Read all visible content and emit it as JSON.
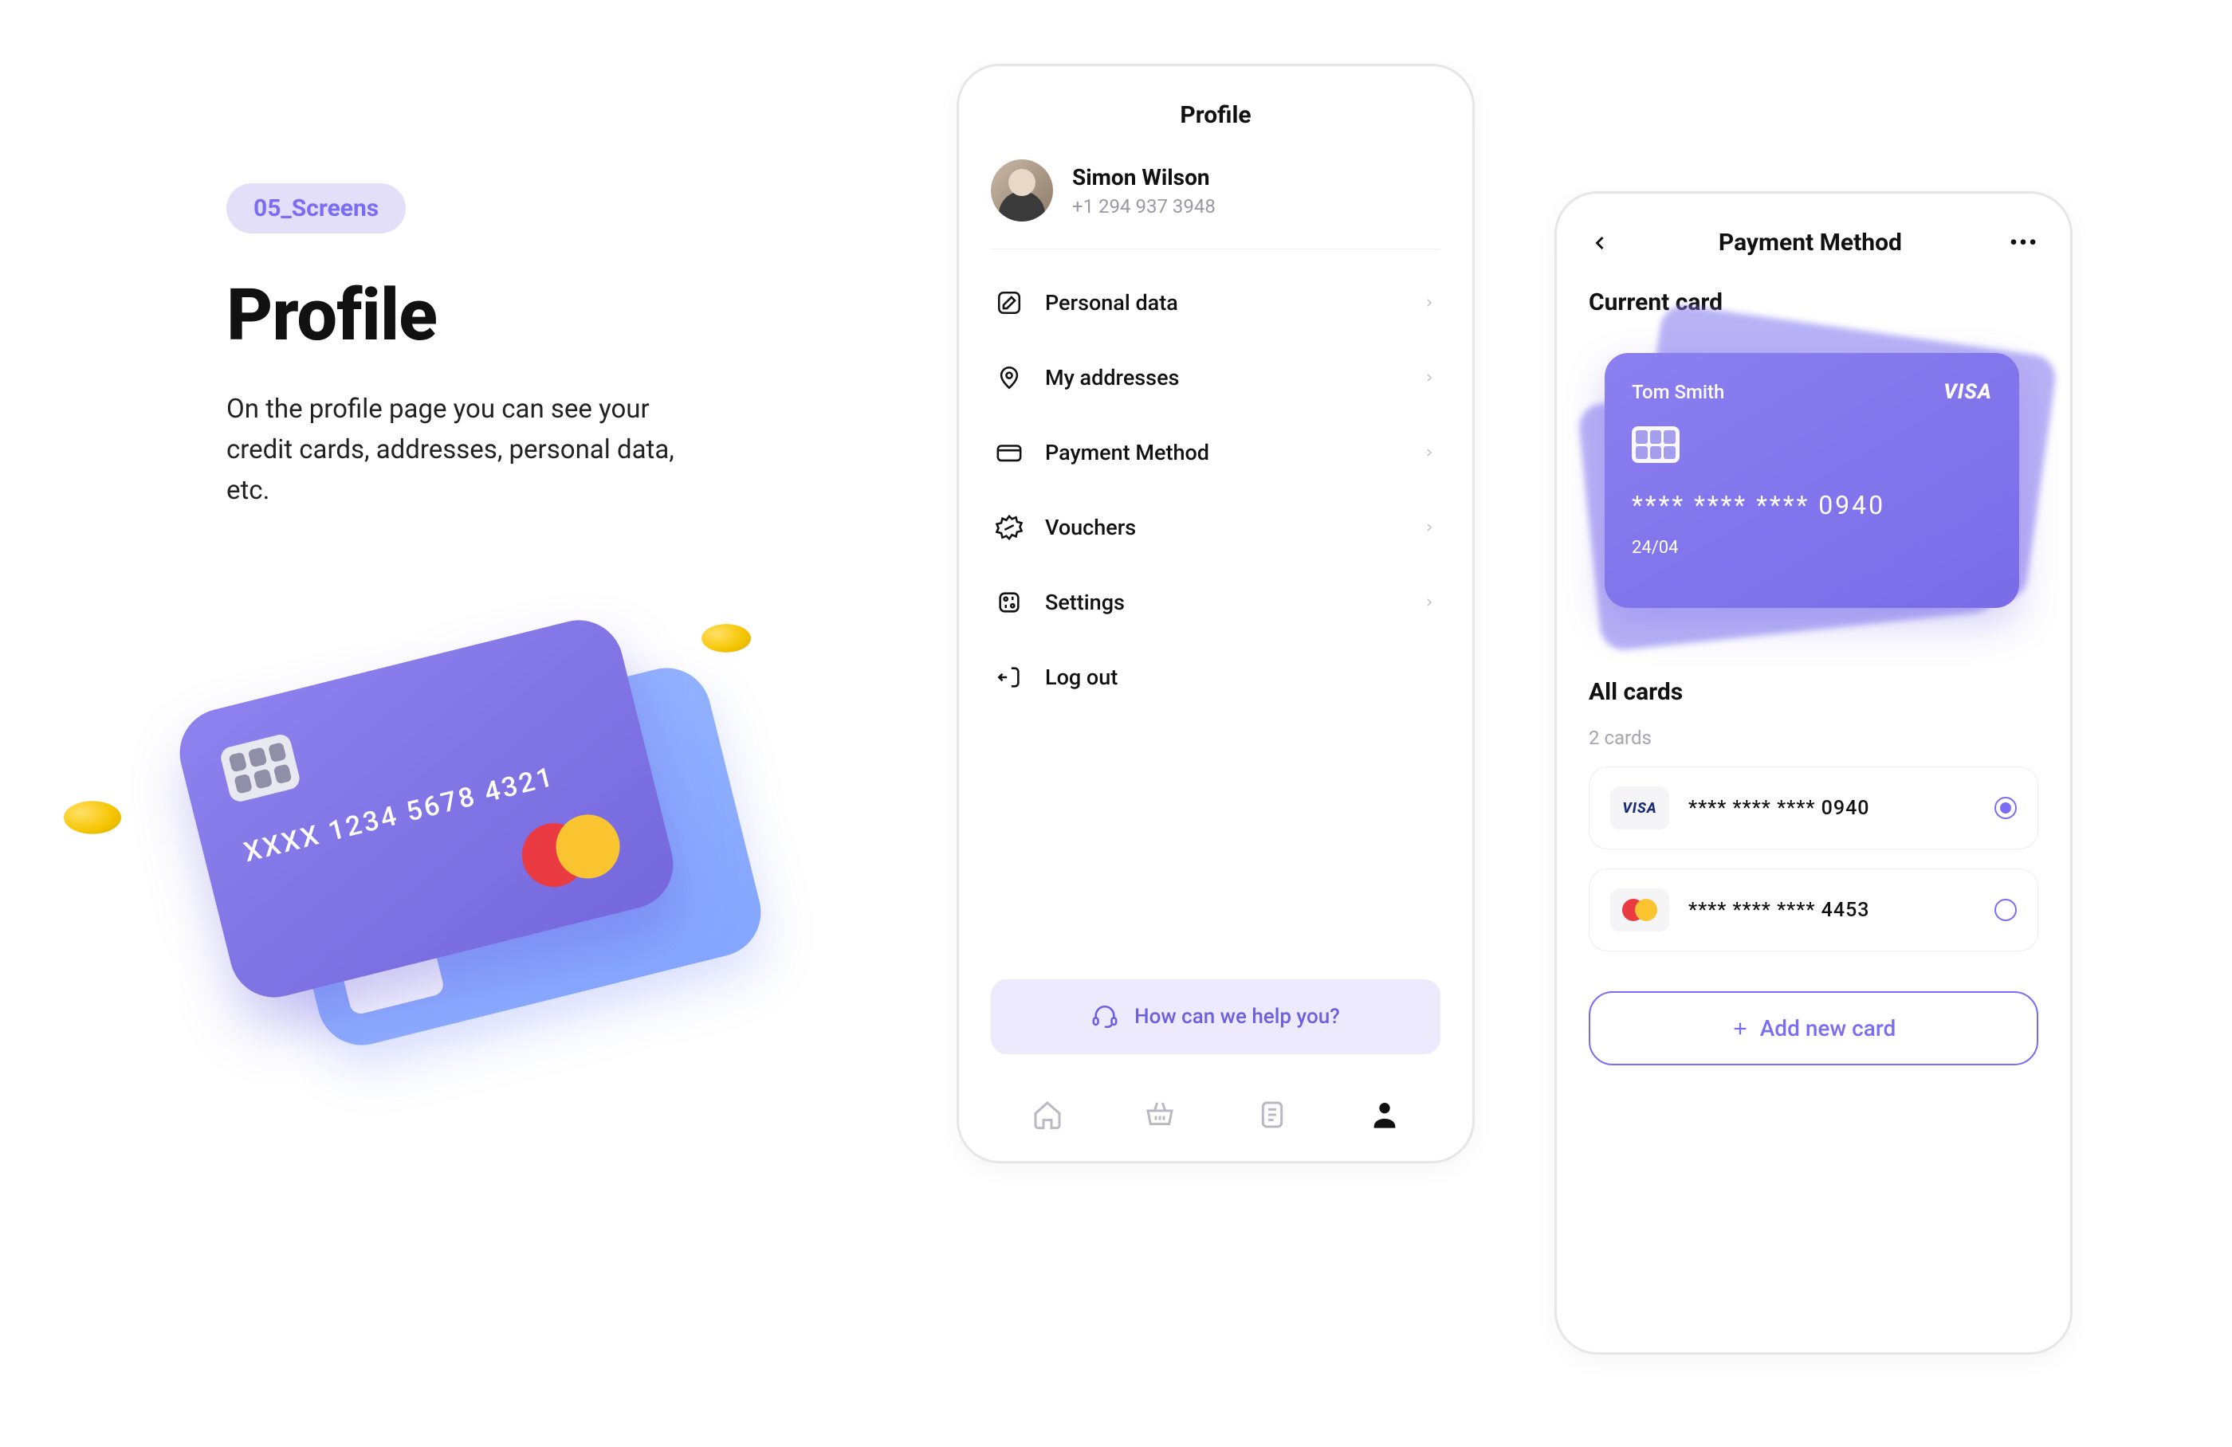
{
  "left": {
    "badge": "05_Screens",
    "heading": "Profile",
    "description": "On the profile page you can see your credit cards, addresses, personal data, etc.",
    "illustration_card_number": "XXXX 1234 5678 4321"
  },
  "profile_screen": {
    "title": "Profile",
    "user": {
      "name": "Simon Wilson",
      "phone": "+1 294 937 3948"
    },
    "menu": [
      {
        "icon": "edit-icon",
        "label": "Personal data"
      },
      {
        "icon": "pin-icon",
        "label": "My addresses"
      },
      {
        "icon": "card-icon",
        "label": "Payment Method"
      },
      {
        "icon": "voucher-icon",
        "label": "Vouchers"
      },
      {
        "icon": "settings-icon",
        "label": "Settings"
      },
      {
        "icon": "logout-icon",
        "label": "Log out"
      }
    ],
    "help_text": "How can we help you?"
  },
  "payment_screen": {
    "title": "Payment Method",
    "current_label": "Current card",
    "current_card": {
      "holder": "Tom Smith",
      "brand": "VISA",
      "number": "**** **** **** 0940",
      "expiry": "24/04"
    },
    "all_cards_label": "All cards",
    "all_cards_count": "2 cards",
    "cards": [
      {
        "brand": "visa",
        "number": "**** **** **** 0940",
        "selected": true
      },
      {
        "brand": "mastercard",
        "number": "**** **** **** 4453",
        "selected": false
      }
    ],
    "add_button": "Add new card"
  },
  "colors": {
    "accent": "#7b6cf6"
  }
}
